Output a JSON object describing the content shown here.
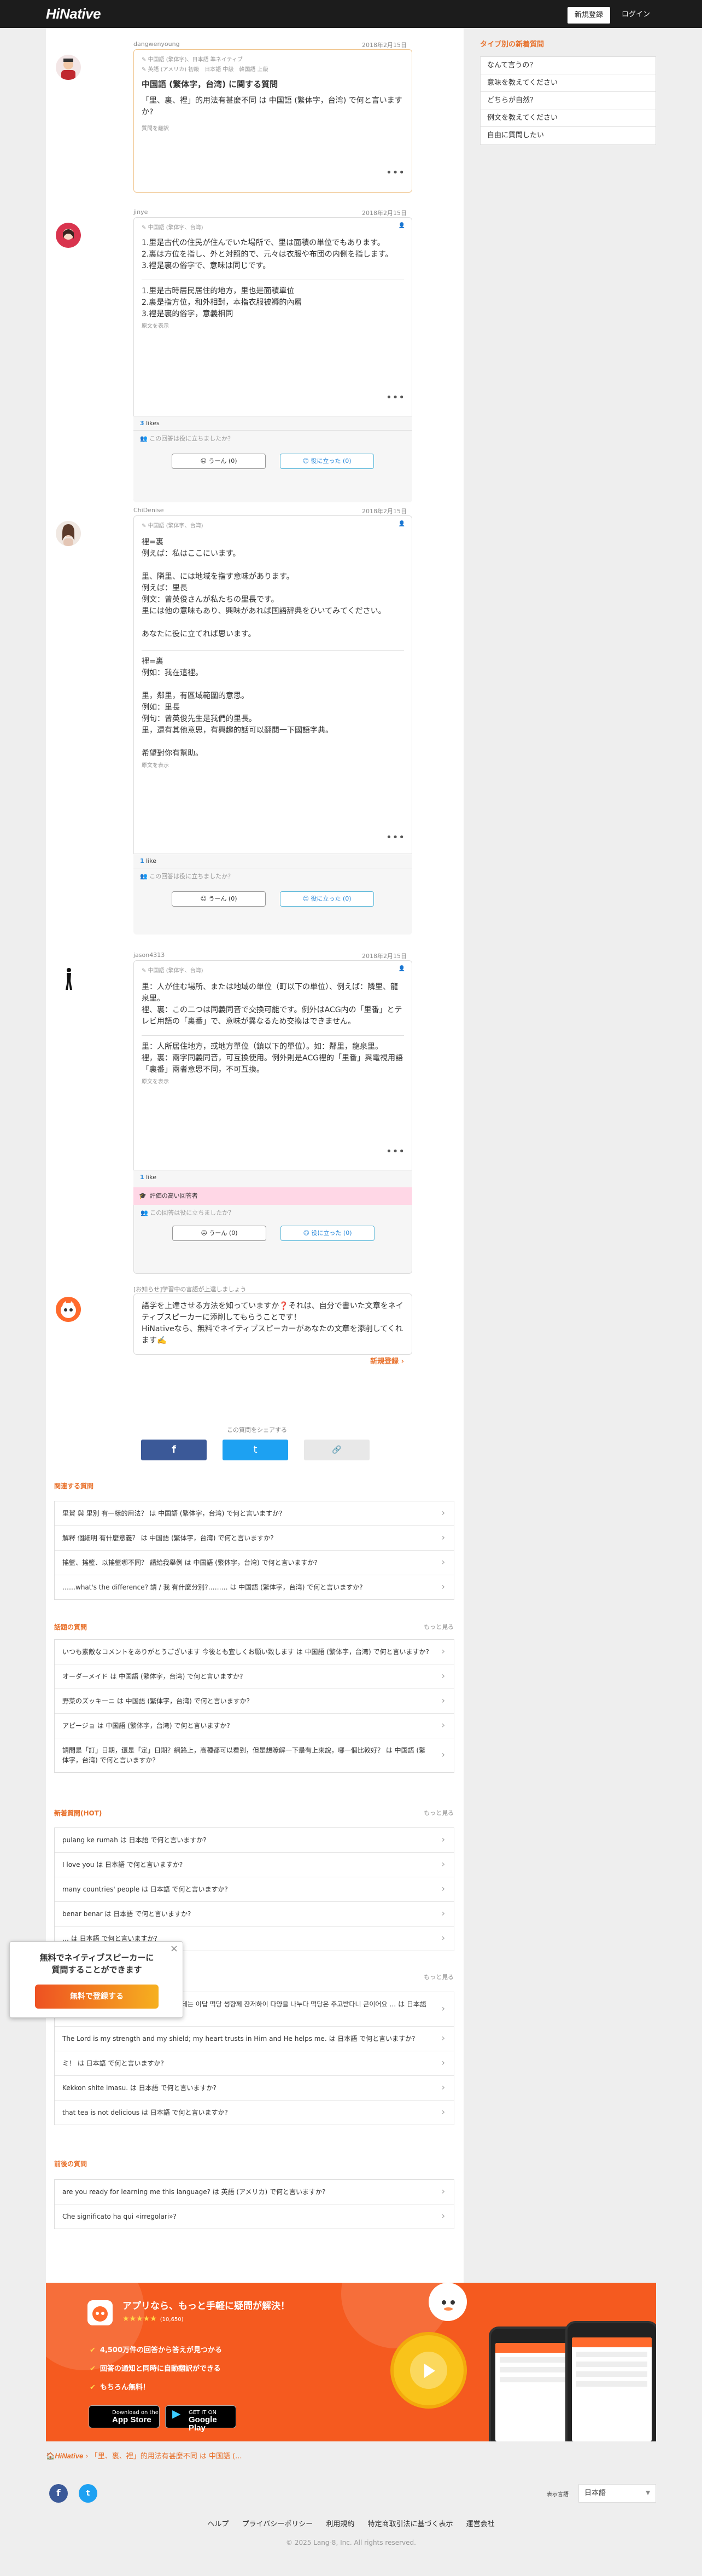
{
  "header": {
    "logo": "HiNative",
    "signup": "新規登録",
    "login": "ログイン"
  },
  "sidebar": {
    "title": "タイプ別の新着質問",
    "items": [
      "なんて言うの？",
      "意味を教えてください",
      "どちらが自然？",
      "例文を教えてください",
      "自由に質問したい"
    ]
  },
  "question": {
    "user": "dangwenyoung",
    "date": "2018年2月15日",
    "lang1": "中国語 (繁体字)、日本語 準ネイティブ",
    "lang2": "英語 (アメリカ) 初級　日本語 中級　韓国語 上級",
    "title": "中国語 (繁体字，台湾) に関する質問",
    "body": "「里、裏、裡」的用法有甚麼不同 は 中国語 (繁体字，台湾) で何と言いますか?",
    "translate": "質問を翻訳"
  },
  "answers": [
    {
      "user": "jinye",
      "date": "2018年2月15日",
      "lang": "中国語 (繁体字、台湾)",
      "body": "1.里是古代の住民が住んでいた場所で、里は面積の単位でもあります。\n2.裏は方位を指し、外と対照的で、元々は衣服や布団の内側を指します。\n3.裡是裏の俗字で、意味は同じです。",
      "body2": "1.里是古時居民居住的地方，里也是面積單位\n2.裏是指方位，和外相對，本指衣服被褥的內層\n3.裡是裏的俗字，意義相同",
      "transl": "原文を表示",
      "likes": "3",
      "likes_label": "likes",
      "ask": "この回答は役に立ちましたか？",
      "no_btn": "うーん (0)",
      "yes_btn": "役に立った (0)"
    },
    {
      "user": "ChiDenise",
      "date": "2018年2月15日",
      "lang": "中国語 (繁体字、台湾)",
      "body": "裡=裏\n例えば：私はここにいます。\n\n里、隣里、には地域を指す意味があります。\n例えば：里長\n例文：曾英俊さんが私たちの里長です。\n里には他の意味もあり、興味があれば国語辞典をひいてみてください。\n\nあなたに役に立てれば思います。",
      "body2": "裡=裏\n例如：我在這裡。\n\n里，鄰里，有區域範圍的意思。\n例如：里長\n例句：曾英俊先生是我們的里長。\n里，還有其他意思，有興趣的話可以翻閱一下國語字典。\n\n希望對你有幫助。",
      "transl": "原文を表示",
      "likes": "1",
      "likes_label": "like",
      "ask": "この回答は役に立ちましたか？",
      "no_btn": "うーん (0)",
      "yes_btn": "役に立った (0)"
    },
    {
      "user": "jason4313",
      "date": "2018年2月15日",
      "lang": "中国語 (繁体字、台湾)",
      "body": "里：人が住む場所、または地域の単位（町以下の単位）、例えば：隣里、龍泉里。\n裡、裏：この二つは同義同音で交換可能です。例外はACG内の「里番」とテレビ用語の「裏番」で、意味が異なるため交換はできません。",
      "body2": "里：人所居住地方，或地方單位（鎮以下的單位）。如：鄰里，龍泉里。\n裡，裏：兩字同義同音，可互換使用。例外則是ACG裡的「里番」與電視用語「裏番」兩者意思不同，不可互換。",
      "transl": "原文を表示",
      "likes": "1",
      "likes_label": "like",
      "badge": "評価の高い回答者",
      "ask": "この回答は役に立ちましたか？",
      "no_btn": "うーん (0)",
      "yes_btn": "役に立った (0)"
    }
  ],
  "info": {
    "label": "[お知らせ]学習中の言語が上達しましょう",
    "text": "語学を上達させる方法を知っていますか❓それは、自分で書いた文章をネイティブスピーカーに添削してもらうことです！\nHiNativeなら、無料でネイティブスピーカーがあなたの文章を添削してくれます✍️",
    "register": "新規登録 ›"
  },
  "share": {
    "label": "この質問をシェアする",
    "facebook": "f",
    "twitter": "t",
    "link": "🔗"
  },
  "related": {
    "title": "関連する質問",
    "items": [
      "里賀 與 里別 有一樣的用法？ は 中国語 (繁体字，台湾) で何と言いますか?",
      "解釋 個細明 有什麼意義？ は 中国語 (繁体字，台湾) で何と言いますか?",
      "搖籃、搖籃、以搖籃哪不同？ 請給我舉例 は 中国語 (繁体字，台湾) で何と言いますか?",
      "……what's the difference? 請 / 我 有什麼分別?……… は 中国語 (繁体字，台湾) で何と言いますか?"
    ]
  },
  "latest": {
    "title": "話題の質問",
    "more": "もっと見る",
    "items": [
      "いつも素敵なコメントをありがとうございます 今後とも宜しくお願い致します は 中国語 (繁体字，台湾) で何と言いますか?",
      "オーダーメイド は 中国語 (繁体字，台湾) で何と言いますか?",
      "野菜のズッキーニ は 中国語 (繁体字，台湾) で何と言いますか?",
      "アピージョ は 中国語 (繁体字，台湾) で何と言いますか?",
      "請問是「訂」日期，還是「定」日期？網路上，高種都可以看到，但是想瞭解一下最有上來說，哪一個比較好？ は 中国語 (繁体字，台湾) で何と言いますか?"
    ]
  },
  "newq": {
    "title": "新着質問(HOT)",
    "more": "もっと見る",
    "items": [
      "pulang ke rumah は 日本語 で何と言いますか?",
      "I love you は 日本語 で何と言いますか?",
      "many countries' people は 日本語 で何と言いますか?",
      "benar benar は 日本語 で何と言いますか?",
      "… は 日本語 で何と言いますか?"
    ]
  },
  "newq2": {
    "more": "もっと見る",
    "items": [
      "… 긍감이 돼지고기랑 안 어울 갔나? 친구한테는 이답 떡당 썽향께 잔저하이 다양을 나누다 떡당은 주고받다니 곤이어요 … は 日本語 で何と言いますか?",
      "The Lord is my strength and my shield; my heart trusts in Him and He helps me. は 日本語 で何と言いますか?",
      "ミ！ は 日本語 で何と言いますか?",
      "Kekkon shite imasu. は 日本語 で何と言いますか?",
      "that tea is not delicious は 日本語 で何と言いますか?"
    ]
  },
  "prev": {
    "title": "前後の質問",
    "items": [
      "are you ready for learning me this language? は 英語 (アメリカ) で何と言いますか?",
      "Che significato ha qui «irregolari»?"
    ]
  },
  "popup": {
    "text": "無料でネイティブスピーカーに\n質問することができます",
    "button": "無料で登録する",
    "close": "×"
  },
  "app_banner": {
    "title": "アプリなら、もっと手軽に疑問が解決！",
    "stars": "★★★★★",
    "rating": "(10,650)",
    "features": [
      "4,500万件の回答から答えが見つかる",
      "回答の通知と同時に自動翻訳ができる",
      "もちろん無料！"
    ],
    "appstore_small": "Download on the",
    "appstore": "App Store",
    "googleplay_small": "GET IT ON",
    "googleplay": "Google Play"
  },
  "breadcrumb": {
    "home": "HiNative",
    "current": "「里、裏、裡」的用法有甚麼不同 は 中国語 (..."
  },
  "footer": {
    "display_lang_label": "表示言語",
    "display_lang": "日本語",
    "links": [
      "ヘルプ",
      "プライバシーポリシー",
      "利用規約",
      "特定商取引法に基づく表示",
      "運営会社"
    ],
    "copyright": "© 2025 Lang-8, Inc. All rights reserved."
  },
  "colors": {
    "accent": "#e8702a",
    "header": "#1c1c1c",
    "banner": "#f55a1f",
    "facebook": "#3b5998",
    "twitter": "#1da1f2"
  }
}
